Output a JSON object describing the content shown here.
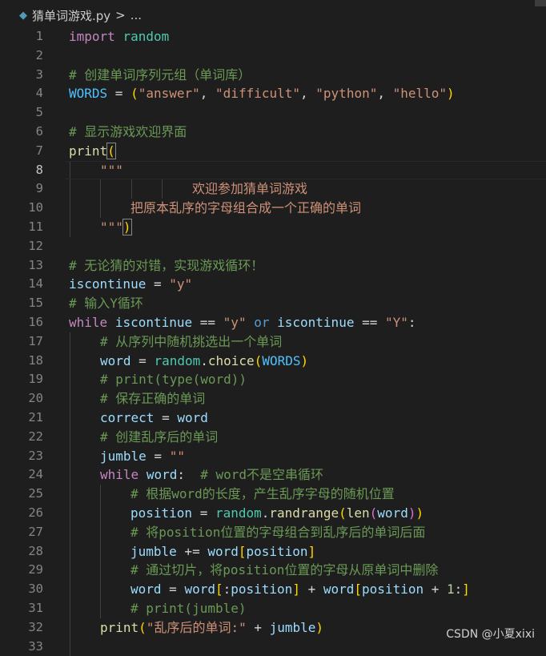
{
  "breadcrumb": {
    "file_icon": "python-file-icon",
    "filename": "猜单词游戏.py",
    "separator": ">",
    "more": "..."
  },
  "editor": {
    "active_line": 8,
    "lines": [
      {
        "n": "1"
      },
      {
        "n": "2"
      },
      {
        "n": "3"
      },
      {
        "n": "4"
      },
      {
        "n": "5"
      },
      {
        "n": "6"
      },
      {
        "n": "7"
      },
      {
        "n": "8"
      },
      {
        "n": "9"
      },
      {
        "n": "10"
      },
      {
        "n": "11"
      },
      {
        "n": "12"
      },
      {
        "n": "13"
      },
      {
        "n": "14"
      },
      {
        "n": "15"
      },
      {
        "n": "16"
      },
      {
        "n": "17"
      },
      {
        "n": "18"
      },
      {
        "n": "19"
      },
      {
        "n": "20"
      },
      {
        "n": "21"
      },
      {
        "n": "22"
      },
      {
        "n": "23"
      },
      {
        "n": "24"
      },
      {
        "n": "25"
      },
      {
        "n": "26"
      },
      {
        "n": "27"
      },
      {
        "n": "28"
      },
      {
        "n": "29"
      },
      {
        "n": "30"
      },
      {
        "n": "31"
      },
      {
        "n": "32"
      },
      {
        "n": "33"
      }
    ],
    "tokens": {
      "import": "import",
      "random": "random",
      "c3": "# 创建单词序列元组（单词库）",
      "WORDS": "WORDS",
      "eq": " = ",
      "lp": "(",
      "rp": ")",
      "s_answer": "\"answer\"",
      "s_difficult": "\"difficult\"",
      "s_python": "\"python\"",
      "s_hello": "\"hello\"",
      "comma": ", ",
      "c6": "# 显示游戏欢迎界面",
      "print": "print",
      "tq": "\"\"\"",
      "l9": "欢迎参加猜单词游戏",
      "l10": "把原本乱序的字母组合成一个正确的单词",
      "c13": "# 无论猜的对错，实现游戏循环！",
      "iscontinue": "iscontinue",
      "s_y": "\"y\"",
      "s_Y": "\"Y\"",
      "c15": "# 输入Y循环",
      "while": "while",
      "eqeq": " == ",
      "or": "or",
      "colon": ":",
      "c17": "# 从序列中随机挑选出一个单词",
      "word": "word",
      "dot": ".",
      "choice": "choice",
      "c19": "# print(type(word))",
      "c20": "# 保存正确的单词",
      "correct": "correct",
      "c22": "# 创建乱序后的单词",
      "jumble": "jumble",
      "s_empty": "\"\"",
      "c24": "# word不是空串循环",
      "c25": "# 根据word的长度，产生乱序字母的随机位置",
      "position": "position",
      "randrange": "randrange",
      "len": "len",
      "c27": "# 将position位置的字母组合到乱序后的单词后面",
      "pluseq": " += ",
      "lb": "[",
      "rb": "]",
      "c29": "# 通过切片，将position位置的字母从原单词中删除",
      "slice_colon": ":",
      "plus": " + ",
      "one": "1",
      "c31": "# print(jumble)",
      "s_result": "\"乱序后的单词:\""
    }
  },
  "watermark": "CSDN @小夏xixi"
}
